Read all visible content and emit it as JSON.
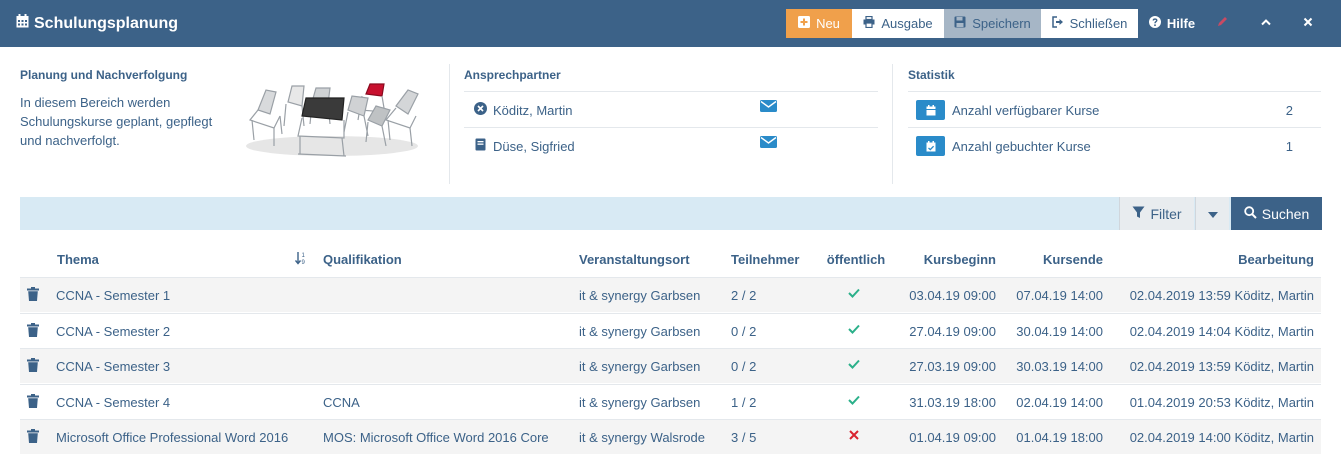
{
  "header": {
    "title": "Schulungsplanung",
    "buttons": {
      "new": "Neu",
      "output": "Ausgabe",
      "save": "Speichern",
      "close": "Schließen",
      "help": "Hilfe"
    }
  },
  "intro": {
    "title": "Planung und Nachverfolgung",
    "text": "In diesem Bereich werden Schulungskurse geplant, gepflegt und nachverfolgt."
  },
  "contacts": {
    "title": "Ansprechpartner",
    "items": [
      {
        "name": "Köditz, Martin",
        "icon": "x-circle-icon"
      },
      {
        "name": "Düse, Sigfried",
        "icon": "book-icon"
      }
    ]
  },
  "statistics": {
    "title": "Statistik",
    "items": [
      {
        "label": "Anzahl verfügbarer Kurse",
        "value": "2"
      },
      {
        "label": "Anzahl gebuchter Kurse",
        "value": "1"
      }
    ]
  },
  "filterbar": {
    "filter_label": "Filter",
    "search_label": "Suchen"
  },
  "table": {
    "columns": {
      "thema": "Thema",
      "qualifikation": "Qualifikation",
      "ort": "Veranstaltungsort",
      "teilnehmer": "Teilnehmer",
      "oeffentlich": "öffentlich",
      "beginn": "Kursbeginn",
      "ende": "Kursende",
      "bearbeitung": "Bearbeitung"
    },
    "rows": [
      {
        "thema": "CCNA - Semester 1",
        "qualifikation": "",
        "ort": "it & synergy Garbsen",
        "teilnehmer": "2 / 2",
        "oeffentlich": true,
        "beginn": "03.04.19 09:00",
        "ende": "07.04.19 14:00",
        "bearbeitung": "02.04.2019 13:59 Köditz, Martin"
      },
      {
        "thema": "CCNA - Semester 2",
        "qualifikation": "",
        "ort": "it & synergy Garbsen",
        "teilnehmer": "0 / 2",
        "oeffentlich": true,
        "beginn": "27.04.19 09:00",
        "ende": "30.04.19 14:00",
        "bearbeitung": "02.04.2019 14:04 Köditz, Martin"
      },
      {
        "thema": "CCNA - Semester 3",
        "qualifikation": "",
        "ort": "it & synergy Garbsen",
        "teilnehmer": "0 / 2",
        "oeffentlich": true,
        "beginn": "27.03.19 09:00",
        "ende": "30.03.19 14:00",
        "bearbeitung": "02.04.2019 13:59 Köditz, Martin"
      },
      {
        "thema": "CCNA - Semester 4",
        "qualifikation": "CCNA",
        "ort": "it & synergy Garbsen",
        "teilnehmer": "1 / 2",
        "oeffentlich": true,
        "beginn": "31.03.19 18:00",
        "ende": "02.04.19 14:00",
        "bearbeitung": "01.04.2019 20:53 Köditz, Martin"
      },
      {
        "thema": "Microsoft Office Professional Word 2016",
        "qualifikation": "MOS: Microsoft Office Word 2016 Core",
        "ort": "it & synergy Walsrode",
        "teilnehmer": "3 / 5",
        "oeffentlich": false,
        "beginn": "01.04.19 09:00",
        "ende": "01.04.19 18:00",
        "bearbeitung": "02.04.2019 14:00 Köditz, Martin"
      }
    ]
  },
  "colors": {
    "header_bg": "#3c6288",
    "accent_orange": "#f0a04b",
    "badge_blue": "#2a8bc9",
    "check_green": "#2bb08a",
    "cross_red": "#d9232f",
    "filterbar_bg": "#d8eaf4"
  }
}
